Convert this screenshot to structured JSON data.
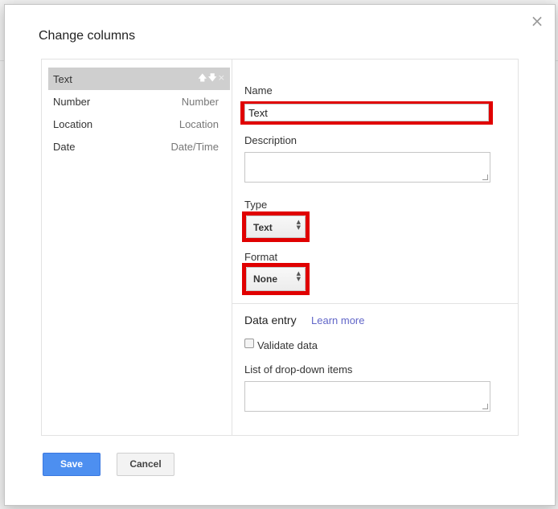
{
  "dialog": {
    "title": "Change columns",
    "close_glyph": "×",
    "save_label": "Save",
    "cancel_label": "Cancel"
  },
  "columns": [
    {
      "name": "Text",
      "type": "",
      "selected": true
    },
    {
      "name": "Number",
      "type": "Number",
      "selected": false
    },
    {
      "name": "Location",
      "type": "Location",
      "selected": false
    },
    {
      "name": "Date",
      "type": "Date/Time",
      "selected": false
    }
  ],
  "item_actions": {
    "up": "🡅",
    "down": "🡇",
    "remove": "×"
  },
  "detail": {
    "name_label": "Name",
    "name_value": "Text",
    "description_label": "Description",
    "description_value": "",
    "type_label": "Type",
    "type_value": "Text",
    "format_label": "Format",
    "format_value": "None",
    "select_arrows": "▲\n▼",
    "data_entry_title": "Data entry",
    "learn_more": "Learn more",
    "validate_label": "Validate data",
    "validate_checked": false,
    "dropdown_items_label": "List of drop-down items",
    "dropdown_items_value": ""
  },
  "colors": {
    "highlight": "#e00000",
    "save_button": "#4d8ff0",
    "link": "#6166c8",
    "selected_row": "#cfcfcf"
  }
}
